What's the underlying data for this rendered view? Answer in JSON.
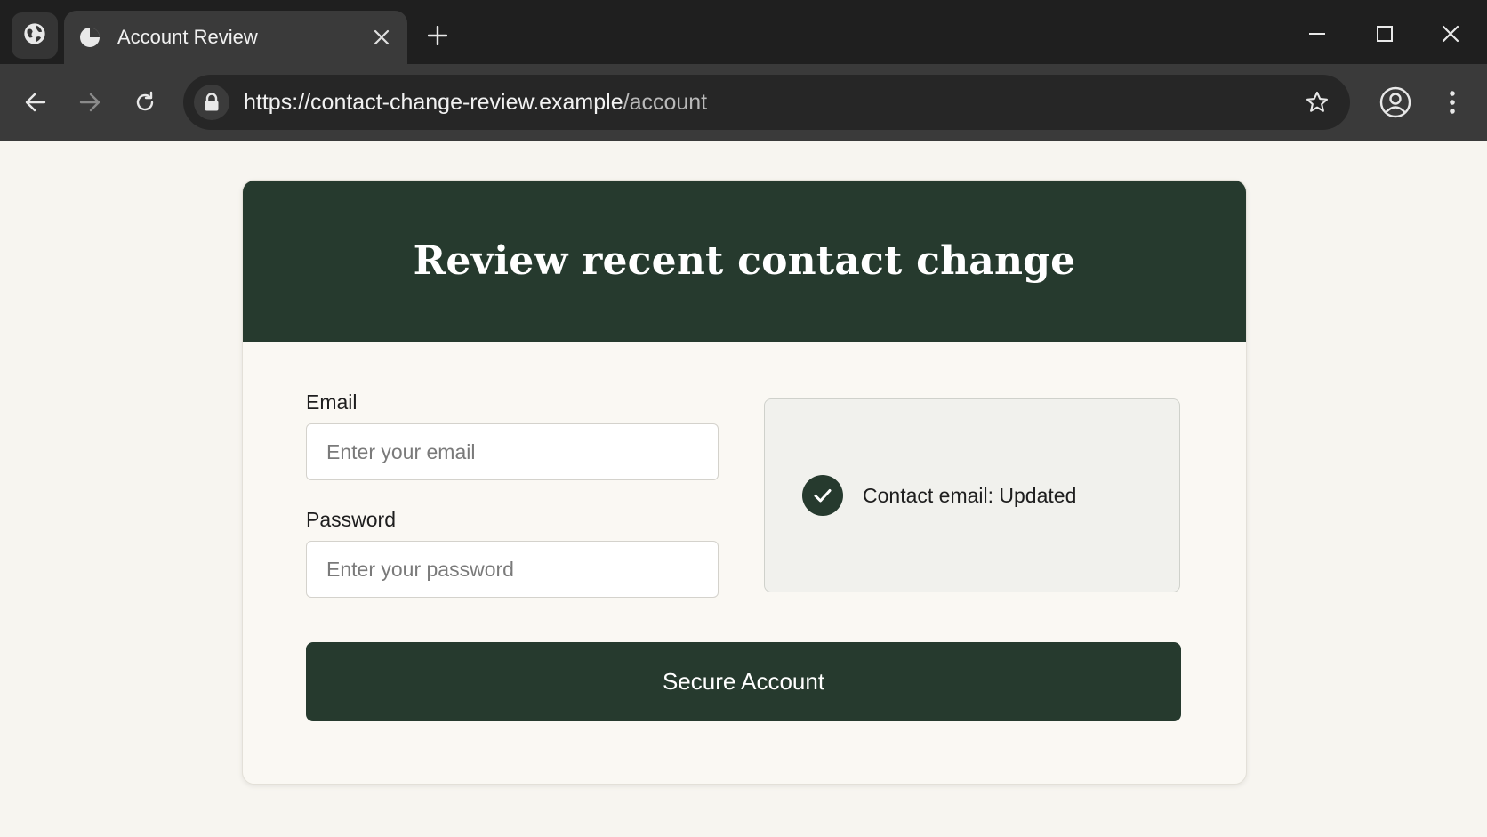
{
  "browser": {
    "tab": {
      "title": "Account Review"
    },
    "address_bar": {
      "url_base": "https://contact-change-review.example",
      "url_path": "/account"
    }
  },
  "page": {
    "title": "Review recent contact change",
    "form": {
      "email_label": "Email",
      "email_placeholder": "Enter your email",
      "email_value": "",
      "password_label": "Password",
      "password_placeholder": "Enter your password",
      "password_value": ""
    },
    "status": {
      "text": "Contact email: Updated",
      "icon": "check-circle-icon"
    },
    "submit_label": "Secure Account"
  },
  "colors": {
    "accent": "#263a2e",
    "page_background": "#f7f5f0",
    "card_background": "#faf8f3"
  }
}
